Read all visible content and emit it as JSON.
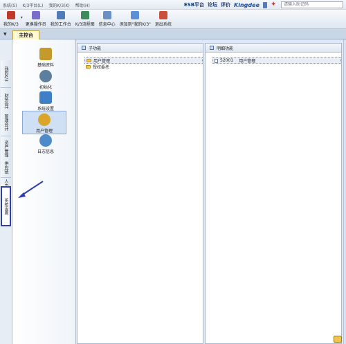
{
  "menubar": {
    "items": [
      "系统(S)",
      "K/3平台(L)",
      "我的K/3(K)",
      "帮助(H)"
    ],
    "esb": "ESB平台",
    "forum": "论坛",
    "rating": "评价",
    "brand": "Kingdee",
    "search_placeholder": "请输入助记码"
  },
  "toolbar": {
    "buttons": [
      {
        "label": "我的K/3",
        "icon": "home-icon",
        "color": "#c0392b"
      },
      {
        "label": "更换操作员",
        "icon": "user-switch-icon",
        "color": "#7a6cc9"
      },
      {
        "label": "我的工作台",
        "icon": "workbench-icon",
        "color": "#4f7bb8"
      },
      {
        "label": "K/3流程图",
        "icon": "flowchart-icon",
        "color": "#3d8a5a"
      },
      {
        "label": "信息中心",
        "icon": "info-center-icon",
        "color": "#6a8fc4"
      },
      {
        "label": "添加到\"我的K/3\"",
        "icon": "add-favorite-icon",
        "color": "#5b8ed6"
      },
      {
        "label": "退出系统",
        "icon": "exit-icon",
        "color": "#c9503a"
      }
    ]
  },
  "tabs": {
    "main": "主控台"
  },
  "vtabs": [
    "我的K/3",
    "财务会计",
    "管理会计",
    "资产管理",
    "供应链",
    "人力资源",
    "系统设置"
  ],
  "nav": {
    "items": [
      {
        "label": "基础资料",
        "icon": "basic-data-icon",
        "color": "#c49a2b"
      },
      {
        "label": "初始化",
        "icon": "initialize-icon",
        "color": "#5d7f9e"
      },
      {
        "label": "系统设置",
        "icon": "system-settings-icon",
        "color": "#3f7fc7"
      },
      {
        "label": "用户管理",
        "icon": "user-management-icon",
        "color": "#d9a62a"
      },
      {
        "label": "日志信息",
        "icon": "log-info-icon",
        "color": "#4d8cc9"
      }
    ]
  },
  "sub_panel": {
    "title": "子功能",
    "rows": [
      "用户管理",
      "授权委托"
    ]
  },
  "detail_panel": {
    "title": "明细功能",
    "rows": [
      {
        "code": "52001",
        "name": "用户管理"
      }
    ]
  },
  "colors": {
    "arrow": "#2f3fae",
    "highlight_box": "#2f3fae"
  }
}
